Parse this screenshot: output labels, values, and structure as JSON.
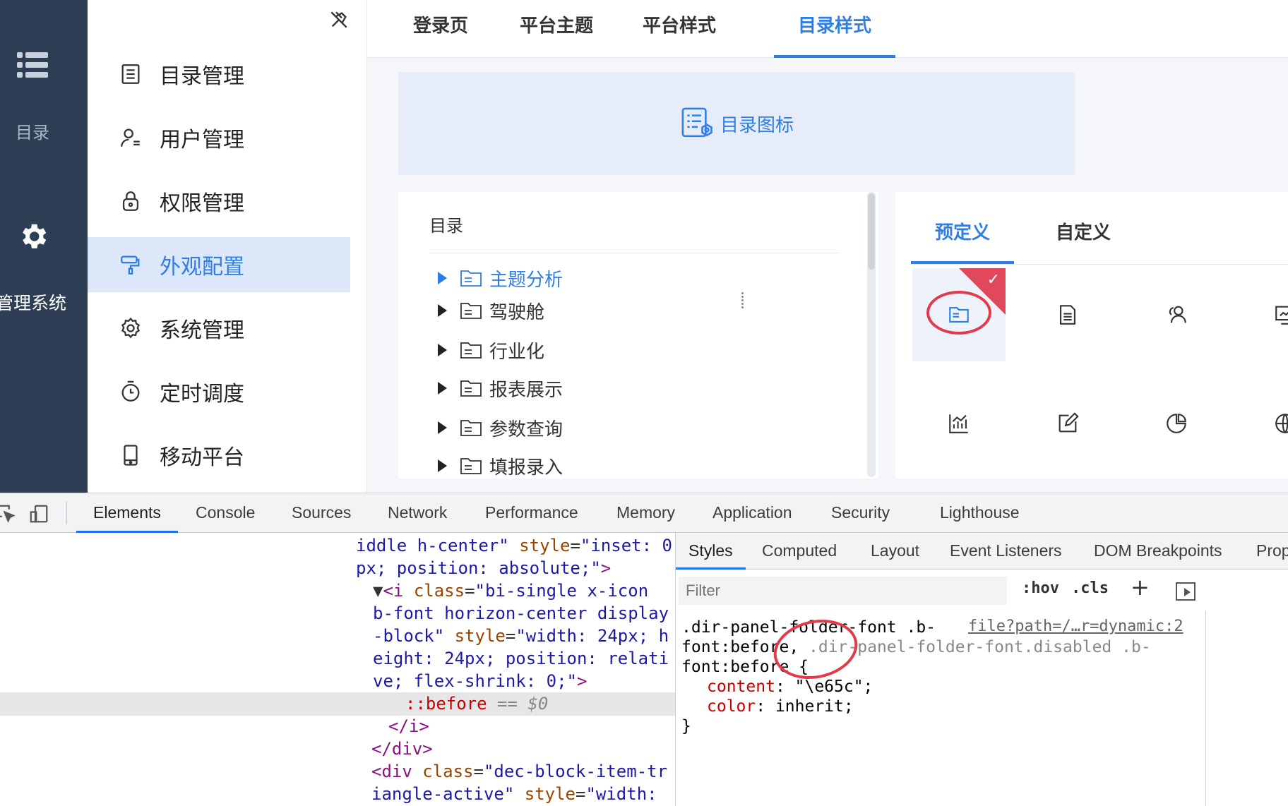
{
  "rail": {
    "catalog_label": "目录",
    "system_label": "管理系统"
  },
  "sidebar": {
    "items": [
      {
        "label": "目录管理",
        "icon": "list-icon"
      },
      {
        "label": "用户管理",
        "icon": "user-icon"
      },
      {
        "label": "权限管理",
        "icon": "lock-icon"
      },
      {
        "label": "外观配置",
        "icon": "paint-roller-icon",
        "active": true
      },
      {
        "label": "系统管理",
        "icon": "gear-icon"
      },
      {
        "label": "定时调度",
        "icon": "timer-icon"
      },
      {
        "label": "移动平台",
        "icon": "mobile-icon"
      }
    ]
  },
  "top_tabs": [
    {
      "label": "登录页"
    },
    {
      "label": "平台主题"
    },
    {
      "label": "平台样式"
    },
    {
      "label": "目录样式",
      "active": true
    }
  ],
  "banner": {
    "label": "目录图标"
  },
  "directory": {
    "header": "目录",
    "items": [
      "主题分析",
      "驾驶舱",
      "行业化",
      "报表展示",
      "参数查询",
      "填报录入"
    ]
  },
  "icon_panel": {
    "tabs": [
      {
        "label": "预定义",
        "active": true
      },
      {
        "label": "自定义"
      }
    ],
    "icons": [
      "folder-icon",
      "document-icon",
      "users-icon",
      "monitor-icon",
      "bar-chart-icon",
      "edit-icon",
      "pie-chart-icon",
      "globe-icon"
    ]
  },
  "devtools": {
    "tabs": [
      "Elements",
      "Console",
      "Sources",
      "Network",
      "Performance",
      "Memory",
      "Application",
      "Security",
      "Lighthouse"
    ],
    "styles_tabs": [
      "Styles",
      "Computed",
      "Layout",
      "Event Listeners",
      "DOM Breakpoints",
      "Prop"
    ],
    "filter_placeholder": "Filter",
    "hov": ":hov",
    "cls": ".cls",
    "elements_lines": [
      "iddle h-center\" style=\"inset: 0",
      "px; position: absolute;\">",
      "▼<i class=\"bi-single x-icon",
      "b-font horizon-center display",
      "-block\" style=\"width: 24px; h",
      "eight: 24px; position: relati",
      "ve; flex-shrink: 0;\">",
      "::before == $0",
      "</i>",
      "</div>",
      "<div class=\"dec-block-item-tr",
      "iangle-active\" style=\"width:"
    ],
    "rule_selector_1": ".dir-panel-folder-font .b-",
    "rule_selector_2": "font:before, ",
    "rule_selector_2b": ".dir-panel-folder-font.disabled .b-",
    "rule_selector_3": "font:before {",
    "prop1_name": "content",
    "prop1_value": ": \"\\e65c\";",
    "prop2_name": "color",
    "prop2_value": ": inherit;",
    "rule_close": "}",
    "source_link": "file?path=/…r=dynamic:2"
  },
  "colors": {
    "accent": "#2f7ee6",
    "rail": "#2e3f55",
    "highlight_ring": "#e33a4a"
  }
}
